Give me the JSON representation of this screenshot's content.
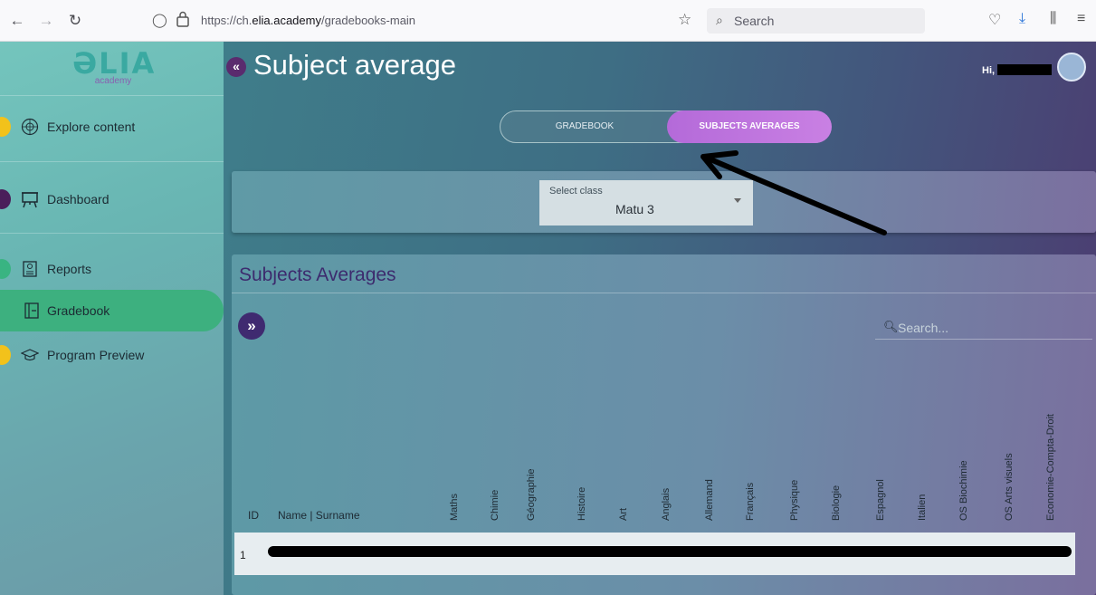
{
  "browser": {
    "url_prefix": "https://ch.",
    "url_domain": "elia.academy",
    "url_path": "/gradebooks-main",
    "search_placeholder": "Search"
  },
  "sidebar": {
    "logo_word": "ƏLIA",
    "logo_sub": "academy",
    "items": [
      {
        "label": "Explore content"
      },
      {
        "label": "Dashboard"
      },
      {
        "label": "Reports"
      },
      {
        "label": "Gradebook"
      },
      {
        "label": "Program Preview"
      }
    ]
  },
  "header": {
    "collapse_glyph": "«",
    "title": "Subject average",
    "greeting": "Hi,"
  },
  "toggle": {
    "gradebook": "GRADEBOOK",
    "subjects_averages": "SUBJECTS AVERAGES"
  },
  "class_select": {
    "caption": "Select class",
    "value": "Matu 3"
  },
  "averages": {
    "title": "Subjects Averages",
    "search_placeholder": "Search...",
    "columns": {
      "id": "ID",
      "name": "Name | Surname",
      "subjects": [
        "Maths",
        "Chimie",
        "Géographie",
        "Histoire",
        "Art",
        "Anglais",
        "Allemand",
        "Français",
        "Physique",
        "Biologie",
        "Espagnol",
        "Italien",
        "OS Biochimie",
        "OS Arts visuels",
        "Economie-Compta-Droit"
      ]
    },
    "rows": [
      {
        "id": "1"
      }
    ]
  },
  "colors": {
    "active_nav": "#3db07f",
    "toggle_active": "#c06fe0",
    "title_purple": "#3d2b6e"
  }
}
